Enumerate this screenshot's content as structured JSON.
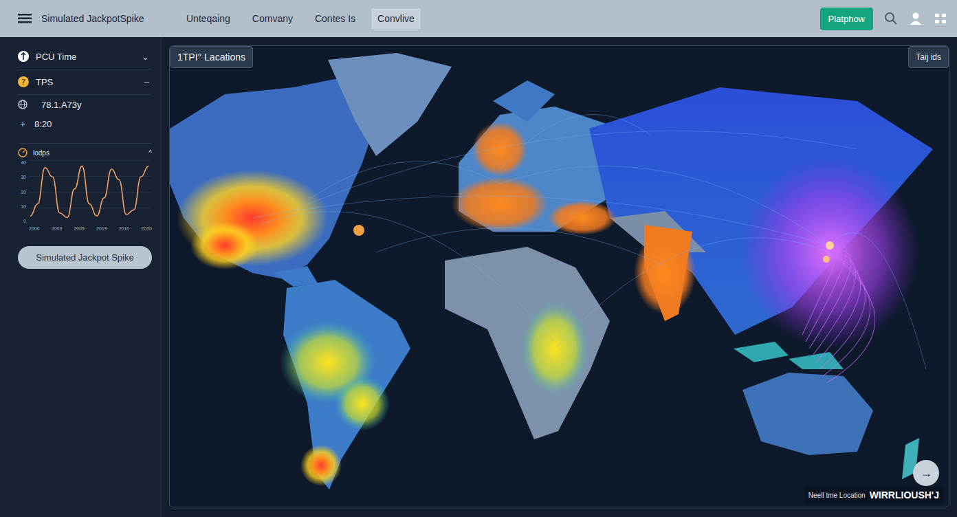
{
  "header": {
    "title": "Simulated JackpotSpike",
    "nav": [
      {
        "label": "Unteqaing",
        "selected": false
      },
      {
        "label": "Comvany",
        "selected": false
      },
      {
        "label": "Contes Is",
        "selected": false
      },
      {
        "label": "Convlive",
        "selected": true
      }
    ],
    "action_button": "Platphow"
  },
  "sidebar": {
    "items": [
      {
        "label": "PCU Time",
        "toggle": "⌄"
      },
      {
        "label": "TPS",
        "toggle": "–"
      }
    ],
    "stats": [
      {
        "sign": "",
        "value": "78.1.A73y"
      },
      {
        "sign": "+",
        "value": "8:20"
      }
    ],
    "chart": {
      "title": "lodps",
      "toggle": "^",
      "y_ticks": [
        "40",
        "30",
        "20",
        "10",
        "0"
      ],
      "x_ticks": [
        "2000",
        "2003",
        "2005",
        "2019",
        "2010",
        "2020"
      ],
      "series": [
        {
          "values": [
            4,
            12,
            36,
            30,
            6,
            3,
            22,
            37,
            12,
            4,
            16,
            35,
            28,
            5,
            8,
            30,
            37
          ]
        }
      ]
    },
    "button": "Simulated Jackpot Spike"
  },
  "map": {
    "title": "1TPI° Lacations",
    "corner_button": "Taij ids",
    "footer": "Neell tme Location",
    "brand": "WIRRLIOUSH'J",
    "next_button": "→"
  }
}
